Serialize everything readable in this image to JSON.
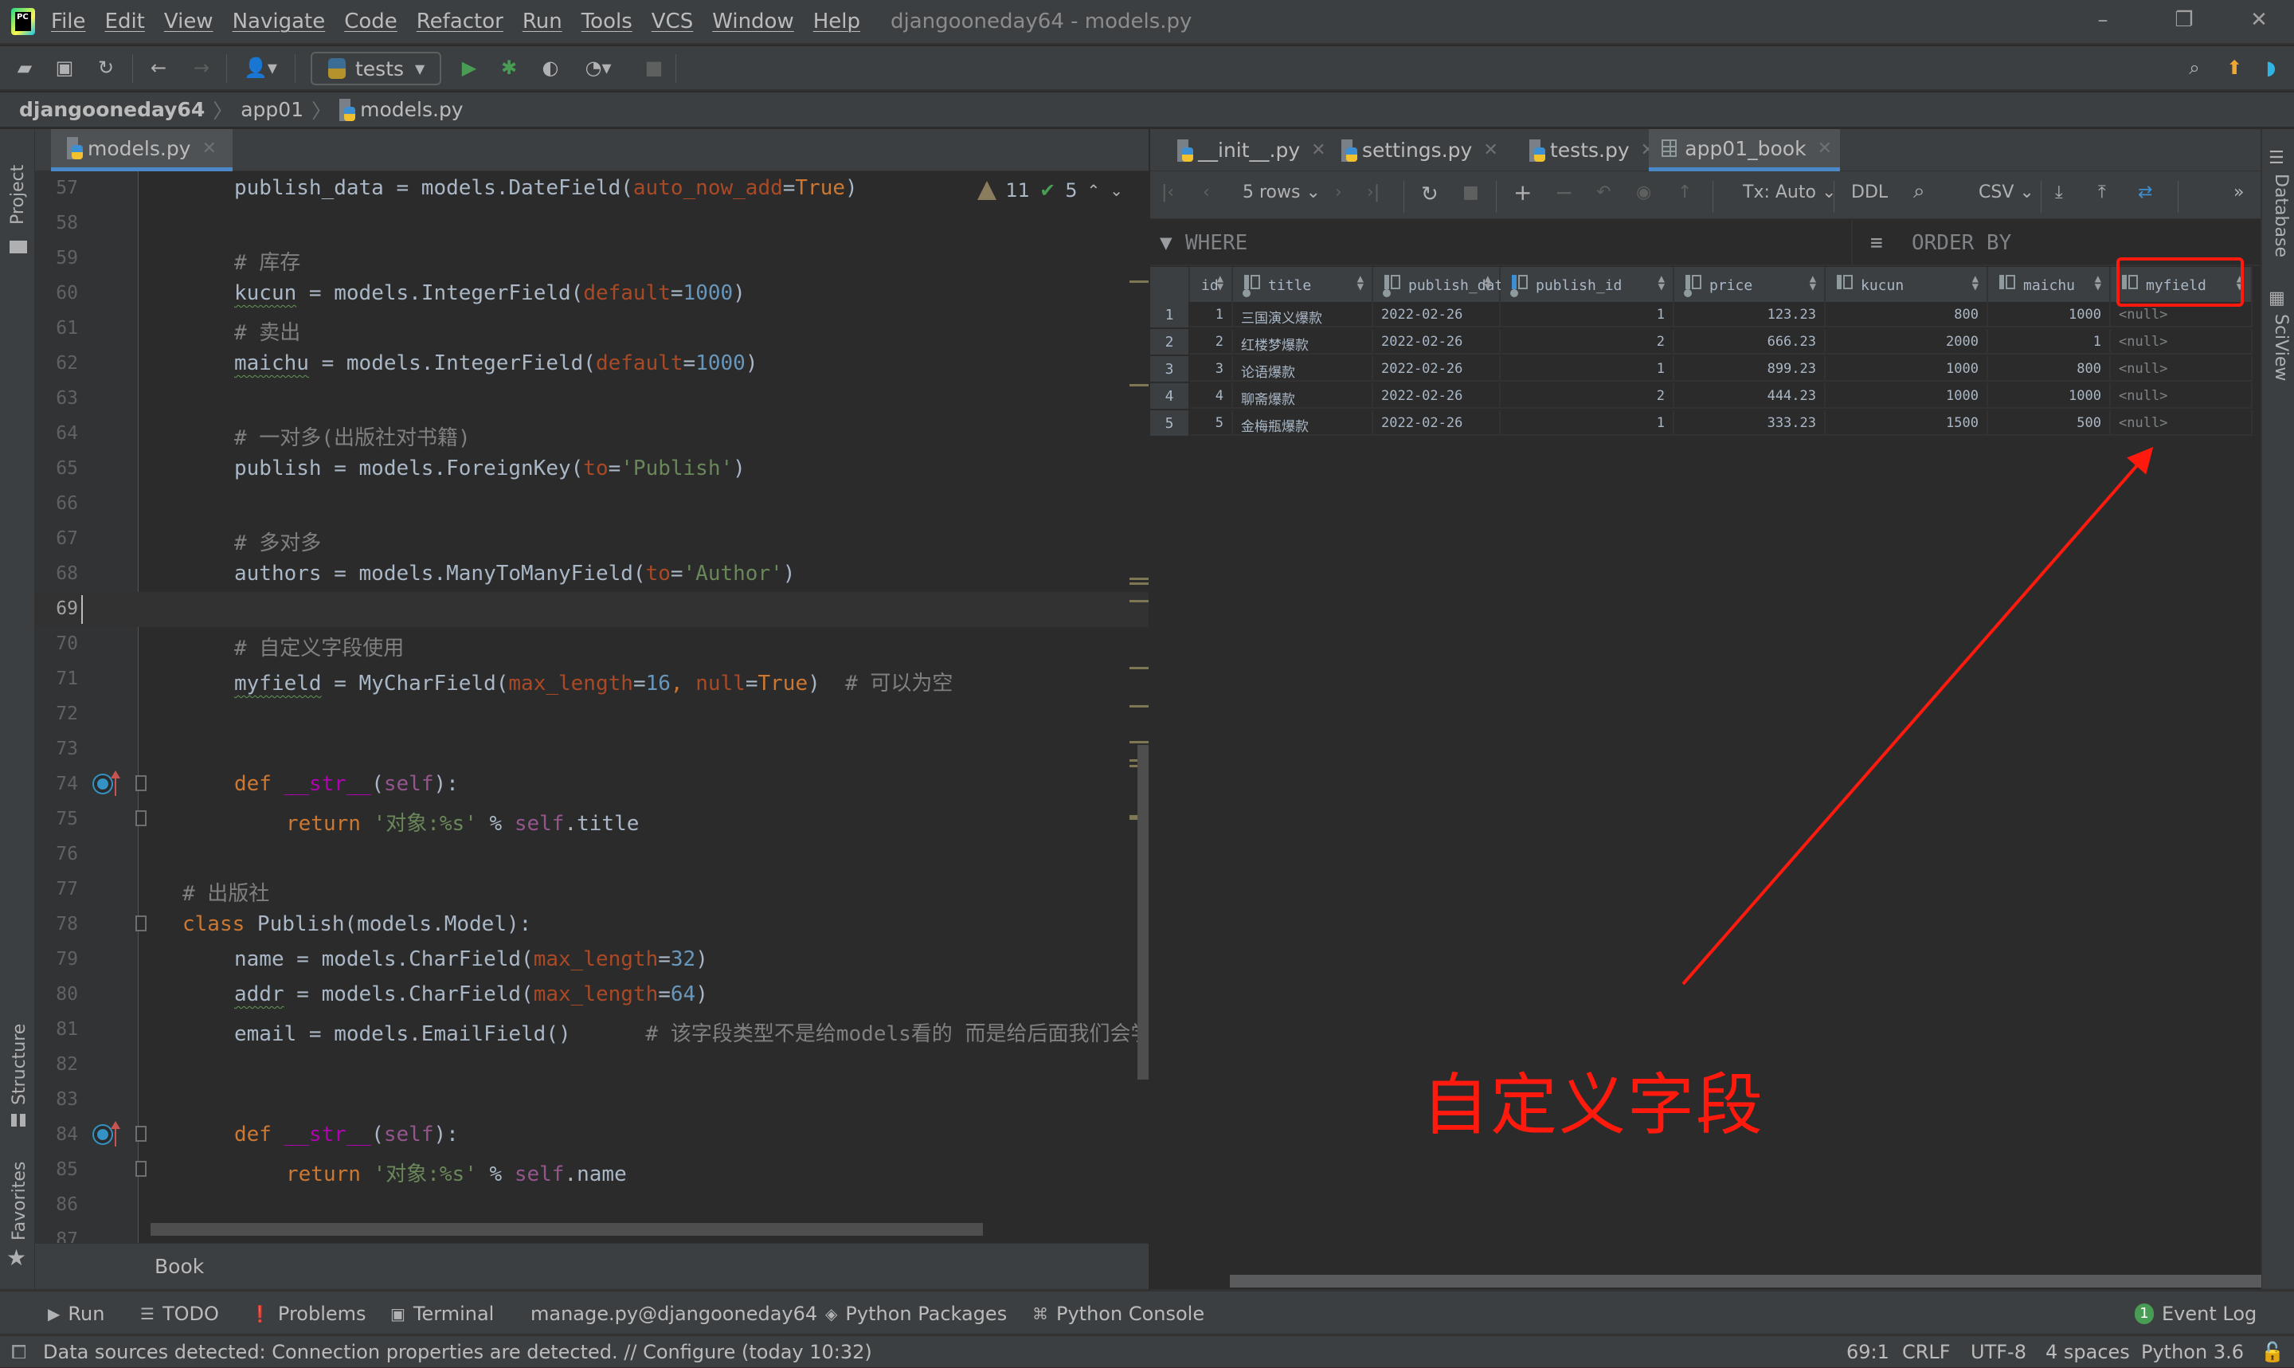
{
  "app": {
    "logo_text": "PC",
    "window_title": "djangooneday64 - models.py",
    "menu": [
      "File",
      "Edit",
      "View",
      "Navigate",
      "Code",
      "Refactor",
      "Run",
      "Tools",
      "VCS",
      "Window",
      "Help"
    ],
    "window_controls": {
      "minimize": "–",
      "restore": "❐",
      "close": "✕"
    }
  },
  "toolbar": {
    "run_config": "tests",
    "icons": [
      "open-folder-icon",
      "save-icon",
      "sync-icon",
      "back-icon",
      "forward-icon",
      "user-icon",
      "run-icon",
      "debug-icon",
      "coverage-icon",
      "profile-icon",
      "stop-icon",
      "search-icon",
      "update-icon",
      "jetbrains-icon"
    ]
  },
  "breadcrumb": [
    "djangooneday64",
    "app01",
    "models.py"
  ],
  "left_strip": {
    "top": "Project",
    "structure": "Structure",
    "favorites": "Favorites"
  },
  "right_strip": {
    "database": "Database",
    "sciview": "SciView"
  },
  "editor": {
    "tab": "models.py",
    "inspections": {
      "warnings": "11",
      "ok": "5"
    },
    "lines": [
      {
        "n": "57",
        "indent": 1,
        "tokens": [
          [
            "publish_data = models.DateField(",
            ""
          ],
          [
            "auto_now_add",
            "param"
          ],
          [
            "=",
            ""
          ],
          [
            "True",
            "kw"
          ],
          [
            ")",
            ""
          ]
        ]
      },
      {
        "n": "58",
        "indent": 1,
        "tokens": []
      },
      {
        "n": "59",
        "indent": 1,
        "tokens": [
          [
            "# 库存",
            "cmt"
          ]
        ]
      },
      {
        "n": "60",
        "indent": 1,
        "tokens": [
          [
            "kucun",
            "wavy"
          ],
          [
            " = models.IntegerField(",
            ""
          ],
          [
            "default",
            "param"
          ],
          [
            "=",
            ""
          ],
          [
            "1000",
            "num"
          ],
          [
            ")",
            ""
          ]
        ]
      },
      {
        "n": "61",
        "indent": 1,
        "tokens": [
          [
            "# 卖出",
            "cmt"
          ]
        ]
      },
      {
        "n": "62",
        "indent": 1,
        "tokens": [
          [
            "maichu",
            "wavy"
          ],
          [
            " = models.IntegerField(",
            ""
          ],
          [
            "default",
            "param"
          ],
          [
            "=",
            ""
          ],
          [
            "1000",
            "num"
          ],
          [
            ")",
            ""
          ]
        ]
      },
      {
        "n": "63",
        "indent": 1,
        "tokens": []
      },
      {
        "n": "64",
        "indent": 1,
        "tokens": [
          [
            "# 一对多(出版社对书籍)",
            "cmt"
          ]
        ]
      },
      {
        "n": "65",
        "indent": 1,
        "tokens": [
          [
            "publish = models.ForeignKey(",
            ""
          ],
          [
            "to",
            "param"
          ],
          [
            "=",
            ""
          ],
          [
            "'Publish'",
            "str"
          ],
          [
            ")",
            ""
          ]
        ]
      },
      {
        "n": "66",
        "indent": 1,
        "tokens": []
      },
      {
        "n": "67",
        "indent": 1,
        "tokens": [
          [
            "# 多对多",
            "cmt"
          ]
        ]
      },
      {
        "n": "68",
        "indent": 1,
        "tokens": [
          [
            "authors = models.ManyToManyField(",
            ""
          ],
          [
            "to",
            "param"
          ],
          [
            "=",
            ""
          ],
          [
            "'Author'",
            "str"
          ],
          [
            ")",
            ""
          ]
        ]
      },
      {
        "n": "69",
        "indent": 0,
        "tokens": [],
        "current": true
      },
      {
        "n": "70",
        "indent": 1,
        "tokens": [
          [
            "# 自定义字段使用",
            "cmt"
          ]
        ]
      },
      {
        "n": "71",
        "indent": 1,
        "tokens": [
          [
            "myfield",
            "wavy"
          ],
          [
            " = MyCharField(",
            ""
          ],
          [
            "max_length",
            "param"
          ],
          [
            "=",
            ""
          ],
          [
            "16",
            "num"
          ],
          [
            ", ",
            "kw"
          ],
          [
            "null",
            "param"
          ],
          [
            "=",
            ""
          ],
          [
            "True",
            "kw"
          ],
          [
            ")",
            ""
          ],
          [
            "  # 可以为空",
            "cmt"
          ]
        ]
      },
      {
        "n": "72",
        "indent": 1,
        "tokens": []
      },
      {
        "n": "73",
        "indent": 1,
        "tokens": []
      },
      {
        "n": "74",
        "indent": 1,
        "tokens": [
          [
            "def ",
            "kw"
          ],
          [
            "__str__",
            "dunder"
          ],
          [
            "(",
            ""
          ],
          [
            "self",
            "self"
          ],
          [
            "):",
            ""
          ]
        ],
        "override": true,
        "fold": true
      },
      {
        "n": "75",
        "indent": 2,
        "tokens": [
          [
            "return ",
            "kw"
          ],
          [
            "'对象:%s'",
            "str"
          ],
          [
            " % ",
            ""
          ],
          [
            "self",
            "self"
          ],
          [
            ".title",
            ""
          ]
        ],
        "fold": true
      },
      {
        "n": "76",
        "indent": 0,
        "tokens": []
      },
      {
        "n": "77",
        "indent": 0,
        "tokens": [
          [
            "# 出版社",
            "cmt"
          ]
        ]
      },
      {
        "n": "78",
        "indent": 0,
        "tokens": [
          [
            "class ",
            "kw"
          ],
          [
            "Publish(models.Model):",
            ""
          ]
        ],
        "fold": true
      },
      {
        "n": "79",
        "indent": 1,
        "tokens": [
          [
            "name = models.CharField(",
            ""
          ],
          [
            "max_length",
            "param"
          ],
          [
            "=",
            ""
          ],
          [
            "32",
            "num"
          ],
          [
            ")",
            ""
          ]
        ]
      },
      {
        "n": "80",
        "indent": 1,
        "tokens": [
          [
            "addr",
            "wavy"
          ],
          [
            " = models.CharField(",
            ""
          ],
          [
            "max_length",
            "param"
          ],
          [
            "=",
            ""
          ],
          [
            "64",
            "num"
          ],
          [
            ")",
            ""
          ]
        ]
      },
      {
        "n": "81",
        "indent": 1,
        "tokens": [
          [
            "email = models.EmailField()",
            ""
          ],
          [
            "      # 该字段类型不是给models看的 而是给后面我们会学到",
            "cmt"
          ]
        ]
      },
      {
        "n": "82",
        "indent": 1,
        "tokens": []
      },
      {
        "n": "83",
        "indent": 1,
        "tokens": []
      },
      {
        "n": "84",
        "indent": 1,
        "tokens": [
          [
            "def ",
            "kw"
          ],
          [
            "__str__",
            "dunder"
          ],
          [
            "(",
            ""
          ],
          [
            "self",
            "self"
          ],
          [
            "):",
            ""
          ]
        ],
        "override": true,
        "fold": true
      },
      {
        "n": "85",
        "indent": 2,
        "tokens": [
          [
            "return ",
            "kw"
          ],
          [
            "'对象:%s'",
            "str"
          ],
          [
            " % ",
            ""
          ],
          [
            "self",
            "self"
          ],
          [
            ".name",
            ""
          ]
        ],
        "fold": true
      },
      {
        "n": "86",
        "indent": 0,
        "tokens": []
      },
      {
        "n": "87",
        "indent": 0,
        "tokens": []
      }
    ],
    "context_breadcrumb": "Book"
  },
  "db_panel": {
    "tabs": [
      {
        "label": "__init__.py",
        "type": "py"
      },
      {
        "label": "settings.py",
        "type": "py"
      },
      {
        "label": "tests.py",
        "type": "py"
      },
      {
        "label": "app01_book",
        "type": "table",
        "active": true
      }
    ],
    "toolbar": {
      "rows": "5 rows",
      "tx": "Tx: Auto",
      "ddl": "DDL",
      "export": "CSV"
    },
    "where_label": "WHERE",
    "order_label": "ORDER BY",
    "columns": [
      "id",
      "title",
      "publish_data",
      "publish_id",
      "price",
      "kucun",
      "maichu",
      "myfield"
    ],
    "rows": [
      [
        "1",
        "1",
        "三国演义爆款",
        "2022-02-26",
        "1",
        "123.23",
        "800",
        "1000",
        "<null>"
      ],
      [
        "2",
        "2",
        "红楼梦爆款",
        "2022-02-26",
        "2",
        "666.23",
        "2000",
        "1",
        "<null>"
      ],
      [
        "3",
        "3",
        "论语爆款",
        "2022-02-26",
        "1",
        "899.23",
        "1000",
        "800",
        "<null>"
      ],
      [
        "4",
        "4",
        "聊斋爆款",
        "2022-02-26",
        "2",
        "444.23",
        "1000",
        "1000",
        "<null>"
      ],
      [
        "5",
        "5",
        "金梅瓶爆款",
        "2022-02-26",
        "1",
        "333.23",
        "1500",
        "500",
        "<null>"
      ]
    ],
    "highlighted_column": "myfield"
  },
  "annotation": {
    "text": "自定义字段",
    "color": "#ff1a0d"
  },
  "tool_windows": [
    {
      "label": "Run",
      "icon": "▶"
    },
    {
      "label": "TODO",
      "icon": "☰"
    },
    {
      "label": "Problems",
      "icon": "❗"
    },
    {
      "label": "Terminal",
      "icon": "▣"
    },
    {
      "label": "manage.py@djangooneday64",
      "icon": ""
    },
    {
      "label": "Python Packages",
      "icon": "◈"
    },
    {
      "label": "Python Console",
      "icon": "⌘"
    }
  ],
  "event_log": {
    "count": "1",
    "label": "Event Log"
  },
  "status": {
    "message": "Data sources detected: Connection properties are detected. // Configure (today 10:32)",
    "position": "69:1",
    "line_sep": "CRLF",
    "encoding": "UTF-8",
    "indent": "4 spaces",
    "interpreter": "Python 3.6"
  },
  "colors": {
    "accent": "#4a88c7",
    "annotation": "#ff1a0d",
    "success": "#499c54"
  }
}
